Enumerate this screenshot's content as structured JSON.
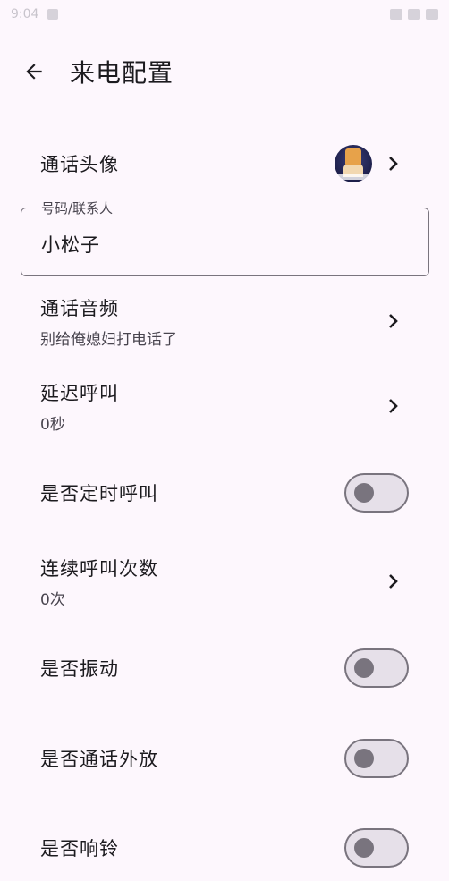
{
  "status_bar": {
    "time": "9:04"
  },
  "header": {
    "title": "来电配置"
  },
  "avatar_row": {
    "label": "通话头像"
  },
  "contact_field": {
    "label": "号码/联系人",
    "value": "小松子"
  },
  "audio_row": {
    "label": "通话音频",
    "value": "别给俺媳妇打电话了"
  },
  "delay_row": {
    "label": "延迟呼叫",
    "value": "0秒"
  },
  "timed_call_row": {
    "label": "是否定时呼叫",
    "enabled": false
  },
  "repeat_row": {
    "label": "连续呼叫次数",
    "value": "0次"
  },
  "vibrate_row": {
    "label": "是否振动",
    "enabled": false
  },
  "speaker_row": {
    "label": "是否通话外放",
    "enabled": false
  },
  "ring_row": {
    "label": "是否响铃",
    "enabled": false
  },
  "colors": {
    "background": "#fdf7fd",
    "switch_track": "#e6e0e9",
    "switch_outline": "#79747e"
  }
}
